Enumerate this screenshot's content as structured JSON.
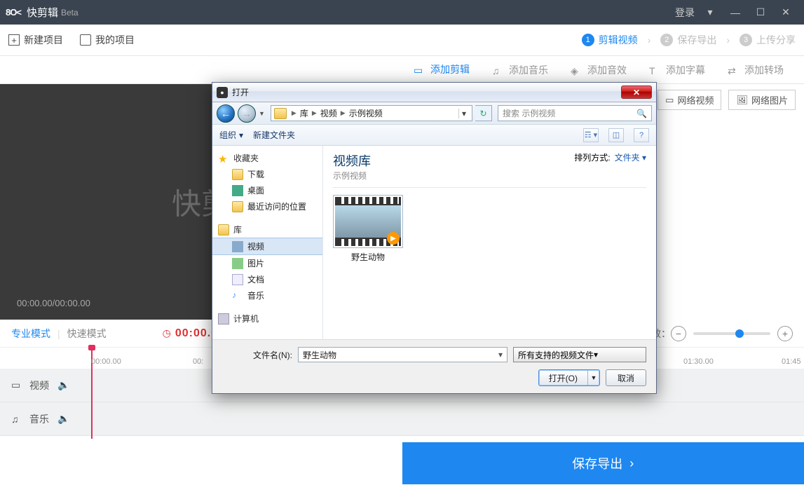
{
  "titlebar": {
    "logo": "8O<",
    "name": "快剪辑",
    "beta": "Beta",
    "login": "登录"
  },
  "toolbar": {
    "new_project": "新建项目",
    "my_projects": "我的项目",
    "steps": [
      {
        "num": "1",
        "label": "剪辑视频",
        "active": true
      },
      {
        "num": "2",
        "label": "保存导出",
        "active": false
      },
      {
        "num": "3",
        "label": "上传分享",
        "active": false
      }
    ]
  },
  "tabs": {
    "add_clip": "添加剪辑",
    "add_music": "添加音乐",
    "add_sfx": "添加音效",
    "add_subtitle": "添加字幕",
    "add_transition": "添加转场"
  },
  "netbtns": {
    "video": "网络视频",
    "image": "网络图片"
  },
  "preview": {
    "watermark": "快剪",
    "time": "00:00.00/00:00.00"
  },
  "modebar": {
    "pro": "专业模式",
    "quick": "快速模式",
    "timecode": "00:00.00",
    "zoom_label": "效："
  },
  "ruler": {
    "t0": "00:00.00",
    "t1": "00:",
    "t2": "01:30.00",
    "t3": "01:45"
  },
  "tracks": {
    "video": "视频",
    "music": "音乐"
  },
  "bottom": {
    "export": "保存导出"
  },
  "dialog": {
    "title": "打开",
    "breadcrumb": [
      "库",
      "视频",
      "示例视频"
    ],
    "search_placeholder": "搜索 示例视频",
    "tools": {
      "organize": "组织",
      "newfolder": "新建文件夹"
    },
    "sidebar": {
      "favorites": "收藏夹",
      "fav_items": [
        "下载",
        "桌面",
        "最近访问的位置"
      ],
      "library": "库",
      "lib_items": [
        "视频",
        "图片",
        "文档",
        "音乐"
      ],
      "computer": "计算机"
    },
    "content": {
      "lib_title": "视频库",
      "lib_sub": "示例视频",
      "sort_label": "排列方式:",
      "sort_value": "文件夹",
      "item_name": "野生动物"
    },
    "bottom": {
      "filename_label": "文件名(N):",
      "filename_value": "野生动物",
      "filetype": "所有支持的视频文件",
      "open": "打开(O)",
      "cancel": "取消"
    }
  }
}
